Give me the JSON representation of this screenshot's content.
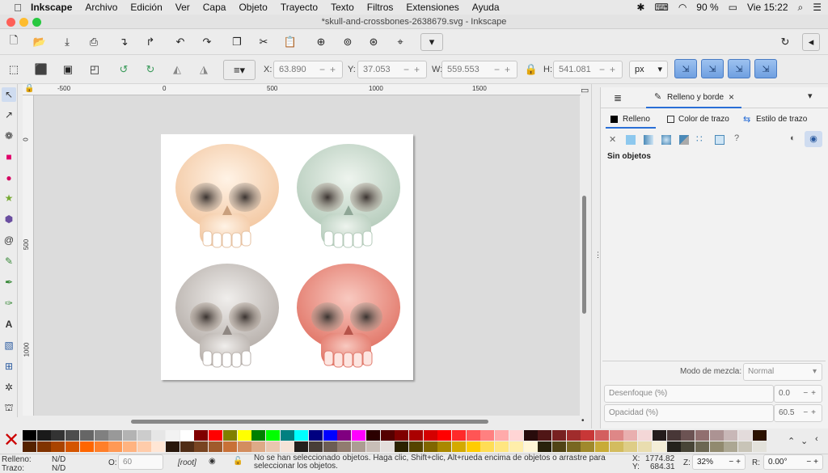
{
  "menubar": {
    "app": "Inkscape",
    "items": [
      "Archivo",
      "Edición",
      "Ver",
      "Capa",
      "Objeto",
      "Trayecto",
      "Texto",
      "Filtros",
      "Extensiones",
      "Ayuda"
    ],
    "battery": "90 %",
    "clock": "Vie 15:22"
  },
  "window": {
    "title": "*skull-and-crossbones-2638679.svg - Inkscape"
  },
  "toolbar": {
    "x_label": "X:",
    "x_value": "63.890",
    "y_label": "Y:",
    "y_value": "37.053",
    "w_label": "W:",
    "w_value": "559.553",
    "h_label": "H:",
    "h_value": "541.081",
    "unit": "px"
  },
  "ruler": {
    "h_ticks": [
      "-500",
      "0",
      "500",
      "1000",
      "1500"
    ],
    "v_ticks": [
      "0",
      "500",
      "1000"
    ]
  },
  "dock": {
    "tab_title": "Relleno y borde",
    "subtabs": [
      "Relleno",
      "Color de trazo",
      "Estilo de trazo"
    ],
    "no_objects": "Sin objetos",
    "blend_label": "Modo de mezcla:",
    "blend_value": "Normal",
    "blur_label": "Desenfoque (%)",
    "blur_value": "0.0",
    "opacity_label": "Opacidad (%)",
    "opacity_value": "60.5",
    "paint_unknown": "?"
  },
  "status": {
    "fill_label": "Relleno:",
    "fill_value": "N/D",
    "stroke_label": "Trazo:",
    "stroke_value": "N/D",
    "o_label": "O:",
    "o_value": "60",
    "layer": "[root]",
    "message_line1": "No se han seleccionado objetos. Haga clic, Shift+clic, Alt+rueda encima de objetos o arrastre para",
    "message_line2": "seleccionar los objetos.",
    "x_label": "X:",
    "x_value": "1774.82",
    "y_label": "Y:",
    "y_value": "684.31",
    "z_label": "Z:",
    "zoom": "32%",
    "r_label": "R:",
    "rotation": "0.00°"
  },
  "palette": {
    "row1": [
      "#000000",
      "#1a1a1a",
      "#333333",
      "#4d4d4d",
      "#666666",
      "#808080",
      "#999999",
      "#b3b3b3",
      "#cccccc",
      "#e6e6e6",
      "#f2f2f2",
      "#ffffff",
      "#800000",
      "#ff0000",
      "#808000",
      "#ffff00",
      "#008000",
      "#00ff00",
      "#008080",
      "#00ffff",
      "#000080",
      "#0000ff",
      "#800080",
      "#ff00ff",
      "#2b0000",
      "#550000",
      "#800000",
      "#aa0000",
      "#d40000",
      "#ff0000",
      "#ff2a2a",
      "#ff5555",
      "#ff8080",
      "#ffaaaa",
      "#ffd5d5",
      "#280b0b",
      "#501616",
      "#782121",
      "#a02c2c",
      "#c83737",
      "#d35f5f",
      "#de8787",
      "#e9afaf",
      "#f4d7d7",
      "#241c1c",
      "#483737",
      "#6c5353",
      "#916f6f",
      "#ac9393",
      "#c8b7b7",
      "#e3dbdb",
      "#2b1100"
    ],
    "row2": [
      "#552200",
      "#803300",
      "#aa4400",
      "#d45500",
      "#ff6600",
      "#ff7f2a",
      "#ff9955",
      "#ffb380",
      "#ffccaa",
      "#ffe6d5",
      "#28170b",
      "#502d16",
      "#784421",
      "#a05a2c",
      "#c87137",
      "#d38d5f",
      "#deaa87",
      "#e9c6af",
      "#f4e3d7",
      "#241f1c",
      "#483e37",
      "#6c5d53",
      "#917c6f",
      "#ac9d93",
      "#c8beb7",
      "#e3dedb",
      "#2b2200",
      "#554400",
      "#806600",
      "#aa8800",
      "#d4aa00",
      "#ffcc00",
      "#ffdd55",
      "#ffe680",
      "#ffeeaa",
      "#fff6d5",
      "#28220b",
      "#504416",
      "#786721",
      "#a0892c",
      "#c8ab37",
      "#d3bc5f",
      "#decd87",
      "#e9ddaf",
      "#f4eed7",
      "#24221c",
      "#484537",
      "#6c6753",
      "#918a6f",
      "#aca793",
      "#c8c4b7",
      "#e3e2db"
    ]
  }
}
